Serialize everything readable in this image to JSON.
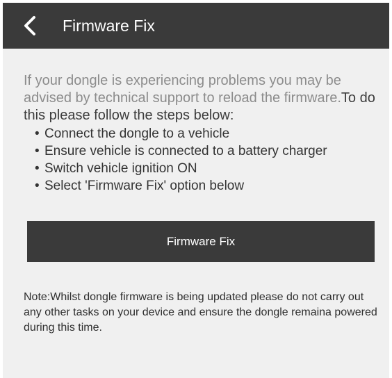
{
  "header": {
    "title": "Firmware Fix",
    "back_icon": "chevron-left-icon",
    "background": "#3a3a3a"
  },
  "intro": {
    "muted_text": "If your dongle is experiencing problems you may be advised by technical support to reload the firmware.",
    "instruction_text": "To do this please follow the steps below:"
  },
  "steps": [
    "Connect the dongle to a vehicle",
    "Ensure vehicle is connected to a battery charger",
    "Switch vehicle ignition ON",
    "Select 'Firmware Fix' option below"
  ],
  "action": {
    "button_label": "Firmware Fix"
  },
  "note": {
    "text": "Note:Whilst dongle firmware is being updated please do not carry out any other tasks on your device and ensure the dongle remaina powered during this time."
  }
}
